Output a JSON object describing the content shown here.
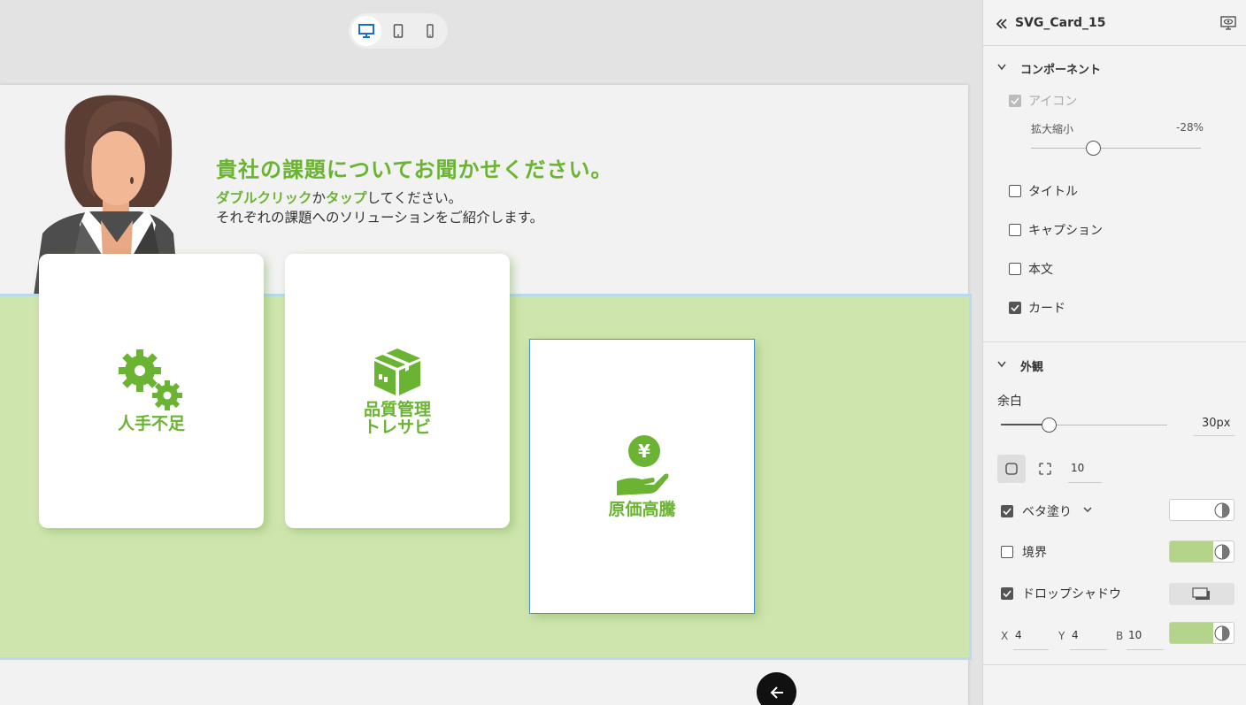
{
  "canvas": {
    "device_toggle": [
      "desktop-icon",
      "tablet-icon",
      "mobile-icon"
    ],
    "heading": "貴社の課題についてお聞かせください。",
    "sub_line1_part1": "ダブルクリック",
    "sub_line1_part2": "か",
    "sub_line1_part3": "タップ",
    "sub_line1_part4": "してください。",
    "sub_line2": "それぞれの課題へのソリューションをご紹介します。",
    "cards": [
      {
        "label_line1": "人手不足",
        "label_line2": "",
        "icon": "gears-icon"
      },
      {
        "label_line1": "品質管理",
        "label_line2": "トレサビ",
        "icon": "box-icon"
      },
      {
        "label_line1": "原価高騰",
        "label_line2": "",
        "icon": "yen-hand-icon"
      }
    ],
    "colors": {
      "accent": "#6ab333",
      "band": "#cfe5ae",
      "selection": "#4a8fc6"
    }
  },
  "panel": {
    "title": "SVG_Card_15",
    "components_section": "コンポーネント",
    "icon_label": "アイコン",
    "scale_label": "拡大縮小",
    "scale_value": "-28%",
    "scale_fraction": 0.4,
    "title_label": "タイトル",
    "caption_label": "キャプション",
    "body_label": "本文",
    "card_label": "カード",
    "appearance_section": "外観",
    "margin_label": "余白",
    "margin_value": "30px",
    "margin_fraction": 0.3,
    "radius_value": "10",
    "fill_label": "ベタ塗り",
    "fill_color": "#ffffff",
    "border_label": "境界",
    "border_color": "#b3d48a",
    "shadow_label": "ドロップシャドウ",
    "shadow_x_label": "X",
    "shadow_x": "4",
    "shadow_y_label": "Y",
    "shadow_y": "4",
    "shadow_b_label": "B",
    "shadow_b": "10",
    "shadow_color": "#b3d48a"
  }
}
